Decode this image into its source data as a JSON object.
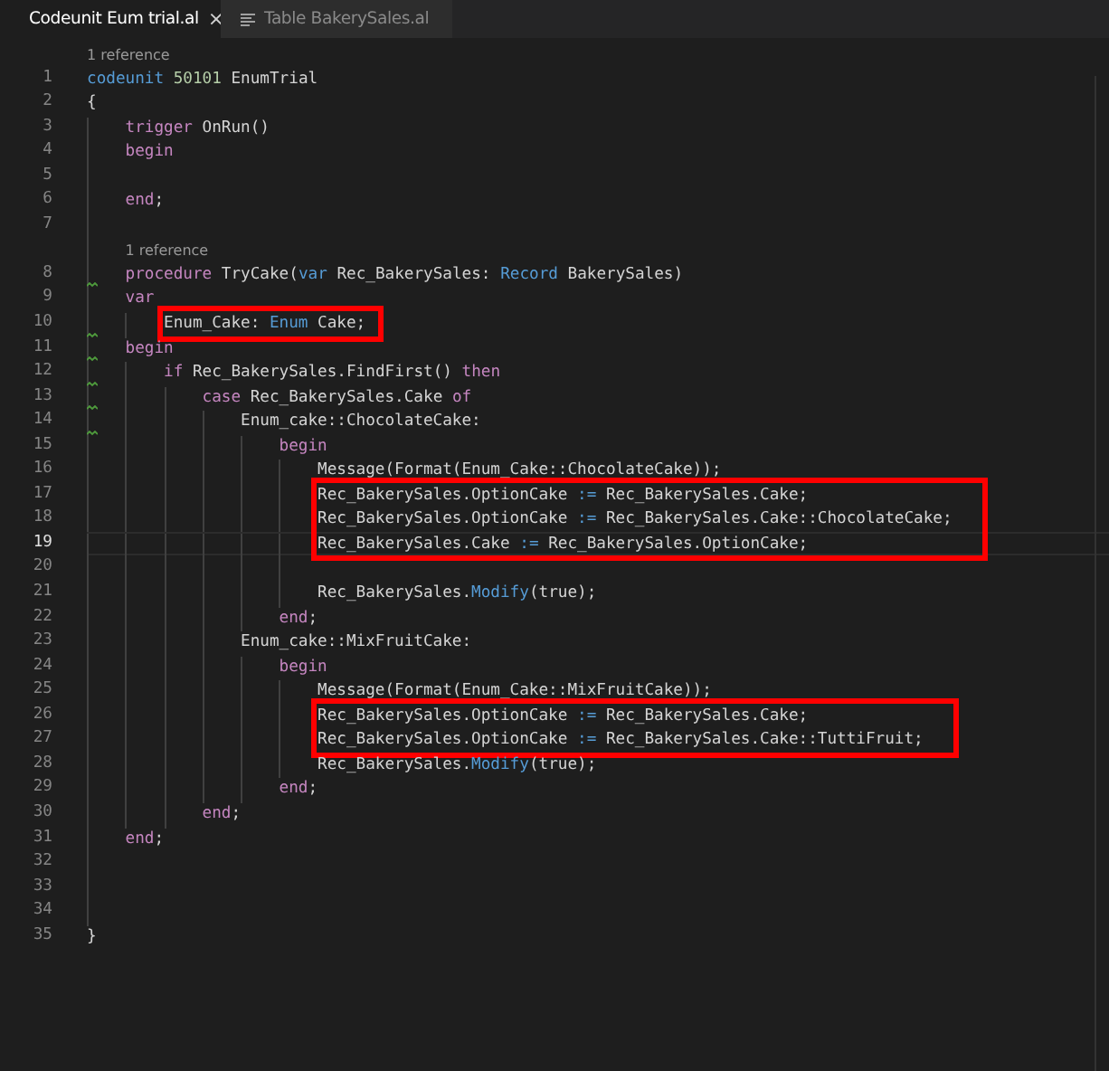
{
  "tabs": [
    {
      "label": "Codeunit Eum trial.al",
      "selected": true,
      "close": "×"
    },
    {
      "label": "Table BakerySales.al",
      "selected": false
    }
  ],
  "editor": {
    "lines": [
      {
        "kind": "codelens",
        "text": "1 reference"
      },
      {
        "number": "1",
        "tokens": [
          {
            "kind": "decl",
            "text": "codeunit "
          },
          {
            "kind": "num",
            "text": "50101"
          },
          {
            "kind": "plain",
            "text": " EnumTrial"
          }
        ]
      },
      {
        "number": "2",
        "tokens": [
          {
            "kind": "plain",
            "text": "{"
          }
        ],
        "children": [
          {
            "number": "3",
            "tokens": [
              {
                "kind": "kw",
                "text": "trigger"
              },
              {
                "kind": "plain",
                "text": " OnRun()"
              }
            ]
          },
          {
            "number": "4",
            "tokens": [
              {
                "kind": "kw",
                "text": "begin"
              }
            ]
          },
          {
            "number": "5"
          },
          {
            "number": "6",
            "tokens": [
              {
                "kind": "kw",
                "text": "end"
              },
              {
                "kind": "plain",
                "text": ";"
              }
            ]
          },
          {
            "number": "7"
          },
          {
            "kind": "codelens",
            "text": "1 reference"
          },
          {
            "number": "8",
            "warning": true,
            "tokens": [
              {
                "kind": "kw",
                "text": "procedure"
              },
              {
                "kind": "plain",
                "text": " TryCake("
              },
              {
                "kind": "decl",
                "text": "var"
              },
              {
                "kind": "plain",
                "text": " Rec_BakerySales: "
              },
              {
                "kind": "decl",
                "text": "Record"
              },
              {
                "kind": "plain",
                "text": " BakerySales)"
              }
            ]
          },
          {
            "number": "9",
            "tokens": [
              {
                "kind": "kw",
                "text": "var"
              }
            ],
            "children": [
              {
                "number": "10",
                "warning": true,
                "boxed": true,
                "tokens": [
                  {
                    "kind": "plain",
                    "text": "Enum_Cake: "
                  },
                  {
                    "kind": "decl",
                    "text": "Enum"
                  },
                  {
                    "kind": "plain",
                    "text": " Cake;"
                  }
                ]
              }
            ]
          },
          {
            "number": "11",
            "warning": true,
            "tokens": [
              {
                "kind": "kw",
                "text": "begin"
              }
            ],
            "children": [
              {
                "number": "12",
                "warning": true,
                "tokens": [
                  {
                    "kind": "kw",
                    "text": "if"
                  },
                  {
                    "kind": "plain",
                    "text": " Rec_BakerySales.FindFirst() "
                  },
                  {
                    "kind": "kw",
                    "text": "then"
                  }
                ],
                "children": [
                  {
                    "number": "13",
                    "warning": true,
                    "tokens": [
                      {
                        "kind": "kw",
                        "text": "case"
                      },
                      {
                        "kind": "plain",
                        "text": " Rec_BakerySales.Cake "
                      },
                      {
                        "kind": "kw",
                        "text": "of"
                      }
                    ],
                    "children": [
                      {
                        "number": "14",
                        "warning": true,
                        "tokens": [
                          {
                            "kind": "plain",
                            "text": "Enum_cake::ChocolateCake:"
                          }
                        ],
                        "children": [
                          {
                            "number": "15",
                            "tokens": [
                              {
                                "kind": "kw",
                                "text": "begin"
                              }
                            ],
                            "children": [
                              {
                                "number": "16",
                                "tokens": [
                                  {
                                    "kind": "plain",
                                    "text": "Message(Format(Enum_Cake::ChocolateCake));"
                                  }
                                ]
                              },
                              {
                                "number": "17",
                                "boxed": true,
                                "tokens": [
                                  {
                                    "kind": "plain",
                                    "text": "Rec_BakerySales.OptionCake "
                                  },
                                  {
                                    "kind": "op",
                                    "text": ":="
                                  },
                                  {
                                    "kind": "plain",
                                    "text": " Rec_BakerySales.Cake;"
                                  }
                                ]
                              },
                              {
                                "number": "18",
                                "boxed": true,
                                "tokens": [
                                  {
                                    "kind": "plain",
                                    "text": "Rec_BakerySales.OptionCake "
                                  },
                                  {
                                    "kind": "op",
                                    "text": ":="
                                  },
                                  {
                                    "kind": "plain",
                                    "text": " Rec_BakerySales.Cake::ChocolateCake;"
                                  }
                                ]
                              },
                              {
                                "number": "19",
                                "boxed": true,
                                "current": true,
                                "tokens": [
                                  {
                                    "kind": "plain",
                                    "text": "Rec_BakerySales.Cake "
                                  },
                                  {
                                    "kind": "op",
                                    "text": ":="
                                  },
                                  {
                                    "kind": "plain",
                                    "text": " Rec_BakerySales.OptionCake;"
                                  }
                                ]
                              },
                              {
                                "number": "20"
                              },
                              {
                                "number": "21",
                                "tokens": [
                                  {
                                    "kind": "plain",
                                    "text": "Rec_BakerySales."
                                  },
                                  {
                                    "kind": "decl",
                                    "text": "Modify"
                                  },
                                  {
                                    "kind": "plain",
                                    "text": "(true);"
                                  }
                                ]
                              }
                            ]
                          },
                          {
                            "number": "22",
                            "tokens": [
                              {
                                "kind": "kw",
                                "text": "end"
                              },
                              {
                                "kind": "plain",
                                "text": ";"
                              }
                            ]
                          }
                        ]
                      },
                      {
                        "number": "23",
                        "tokens": [
                          {
                            "kind": "plain",
                            "text": "Enum_cake::MixFruitCake:"
                          }
                        ],
                        "children": [
                          {
                            "number": "24",
                            "tokens": [
                              {
                                "kind": "kw",
                                "text": "begin"
                              }
                            ],
                            "children": [
                              {
                                "number": "25",
                                "tokens": [
                                  {
                                    "kind": "plain",
                                    "text": "Message(Format(Enum_Cake::MixFruitCake));"
                                  }
                                ]
                              },
                              {
                                "number": "26",
                                "boxed": true,
                                "tokens": [
                                  {
                                    "kind": "plain",
                                    "text": "Rec_BakerySales.OptionCake "
                                  },
                                  {
                                    "kind": "op",
                                    "text": ":="
                                  },
                                  {
                                    "kind": "plain",
                                    "text": " Rec_BakerySales.Cake;"
                                  }
                                ]
                              },
                              {
                                "number": "27",
                                "boxed": true,
                                "tokens": [
                                  {
                                    "kind": "plain",
                                    "text": "Rec_BakerySales.OptionCake "
                                  },
                                  {
                                    "kind": "op",
                                    "text": ":="
                                  },
                                  {
                                    "kind": "plain",
                                    "text": " Rec_BakerySales.Cake::TuttiFruit;"
                                  }
                                ]
                              },
                              {
                                "number": "28",
                                "tokens": [
                                  {
                                    "kind": "plain",
                                    "text": "Rec_BakerySales."
                                  },
                                  {
                                    "kind": "decl",
                                    "text": "Modify"
                                  },
                                  {
                                    "kind": "plain",
                                    "text": "(true);"
                                  }
                                ]
                              }
                            ]
                          },
                          {
                            "number": "29",
                            "tokens": [
                              {
                                "kind": "kw",
                                "text": "end"
                              },
                              {
                                "kind": "plain",
                                "text": ";"
                              }
                            ]
                          }
                        ]
                      }
                    ]
                  },
                  {
                    "number": "30",
                    "tokens": [
                      {
                        "kind": "kw",
                        "text": "end"
                      },
                      {
                        "kind": "plain",
                        "text": ";"
                      }
                    ]
                  }
                ]
              }
            ]
          },
          {
            "number": "31",
            "tokens": [
              {
                "kind": "kw",
                "text": "end"
              },
              {
                "kind": "plain",
                "text": ";"
              }
            ]
          },
          {
            "number": "32"
          },
          {
            "number": "33"
          },
          {
            "number": "34"
          }
        ]
      },
      {
        "number": "35",
        "tokens": [
          {
            "kind": "plain",
            "text": "}"
          }
        ]
      }
    ]
  }
}
